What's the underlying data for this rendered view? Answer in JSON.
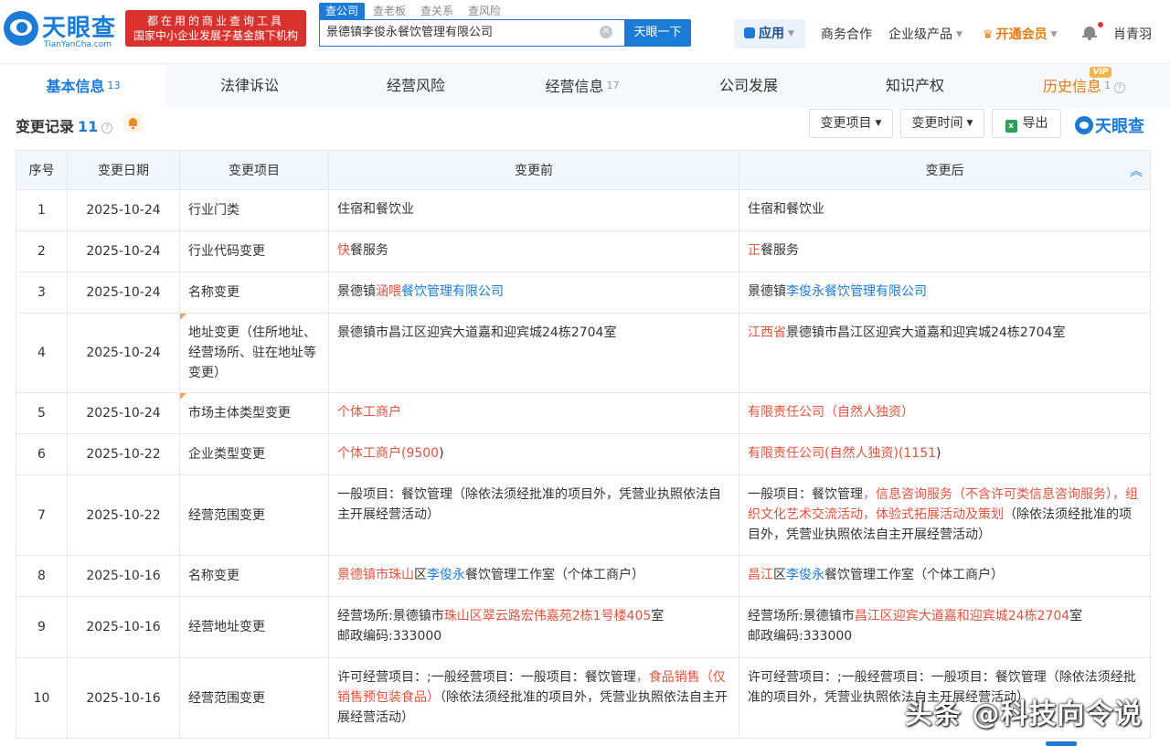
{
  "header": {
    "logo_name": "天眼查",
    "logo_sub": "TianYanCha.com",
    "slogan_line1": "都在用的商业查询工具",
    "slogan_line2": "国家中小企业发展子基金旗下机构",
    "search_tabs": [
      "查公司",
      "查老板",
      "查关系",
      "查风险"
    ],
    "search_value": "景德镇李俊永餐饮管理有限公司",
    "search_button": "天眼一下",
    "nav_apps": "应用",
    "nav_business": "商务合作",
    "nav_enterprise": "企业级产品",
    "nav_vip": "开通会员",
    "user_name": "肖青羽"
  },
  "tabs": [
    {
      "label": "基本信息",
      "count": "13"
    },
    {
      "label": "法律诉讼",
      "count": ""
    },
    {
      "label": "经营风险",
      "count": ""
    },
    {
      "label": "经营信息",
      "count": "17"
    },
    {
      "label": "公司发展",
      "count": ""
    },
    {
      "label": "知识产权",
      "count": ""
    },
    {
      "label": "历史信息",
      "count": "1"
    }
  ],
  "vip_badge": "VIP",
  "section": {
    "title": "变更记录",
    "count": "11",
    "filter_item": "变更项目",
    "filter_time": "变更时间",
    "export": "导出",
    "brand": "天眼查"
  },
  "table": {
    "headers": [
      "序号",
      "变更日期",
      "变更项目",
      "变更前",
      "变更后"
    ],
    "rows": [
      {
        "no": "1",
        "date": "2025-10-24",
        "item": "行业门类",
        "before": [
          {
            "t": "住宿和餐饮业"
          }
        ],
        "after": [
          {
            "t": "住宿和餐饮业"
          }
        ]
      },
      {
        "no": "2",
        "date": "2025-10-24",
        "item": "行业代码变更",
        "before": [
          {
            "t": "快",
            "c": "hl"
          },
          {
            "t": "餐服务"
          }
        ],
        "after": [
          {
            "t": "正",
            "c": "hl"
          },
          {
            "t": "餐服务"
          }
        ]
      },
      {
        "no": "3",
        "date": "2025-10-24",
        "item": "名称变更",
        "before": [
          {
            "t": "景德镇"
          },
          {
            "t": "涵喂",
            "c": "hl"
          },
          {
            "t": "餐饮管理有限公司",
            "c": "lk"
          }
        ],
        "after": [
          {
            "t": "景德镇"
          },
          {
            "t": "李俊永餐饮管理有限公司",
            "c": "lk"
          }
        ]
      },
      {
        "no": "4",
        "date": "2025-10-24",
        "item": "地址变更（住所地址、经营场所、驻在地址等变更）",
        "before": [
          {
            "t": "景德镇市昌江区迎宾大道嘉和迎宾城24栋2704室"
          }
        ],
        "after": [
          {
            "t": "江西省",
            "c": "hl"
          },
          {
            "t": "景德镇市昌江区迎宾大道嘉和迎宾城24栋2704室"
          }
        ]
      },
      {
        "no": "5",
        "date": "2025-10-24",
        "item": "市场主体类型变更",
        "before": [
          {
            "t": "个体工商户",
            "c": "hl"
          }
        ],
        "after": [
          {
            "t": "有限责任公司（自然人独资）",
            "c": "hl"
          }
        ]
      },
      {
        "no": "6",
        "date": "2025-10-22",
        "item": "企业类型变更",
        "before": [
          {
            "t": "个体工商户(9500",
            "c": "hl"
          },
          {
            "t": ")"
          }
        ],
        "after": [
          {
            "t": "有限责任公司(自然人独资)(1151",
            "c": "hl"
          },
          {
            "t": ")"
          }
        ]
      },
      {
        "no": "7",
        "date": "2025-10-22",
        "item": "经营范围变更",
        "before": [
          {
            "t": "一般项目：餐饮管理（除依法须经批准的项目外，凭营业执照依法自主开展经营活动）"
          }
        ],
        "after": [
          {
            "t": "一般项目：餐饮管理"
          },
          {
            "t": "，信息咨询服务（不含许可类信息咨询服务），组织文化艺术交流活动，体验式拓展活动及策划",
            "c": "hl"
          },
          {
            "t": "（除依法须经批准的项目外，凭营业执照依法自主开展经营活动）"
          }
        ]
      },
      {
        "no": "8",
        "date": "2025-10-16",
        "item": "名称变更",
        "before": [
          {
            "t": "景德镇市珠山",
            "c": "hl"
          },
          {
            "t": "区"
          },
          {
            "t": "李俊永",
            "c": "lk"
          },
          {
            "t": "餐饮管理工作室（个体工商户）"
          }
        ],
        "after": [
          {
            "t": "昌江",
            "c": "hl"
          },
          {
            "t": "区"
          },
          {
            "t": "李俊永",
            "c": "lk"
          },
          {
            "t": "餐饮管理工作室（个体工商户）"
          }
        ]
      },
      {
        "no": "9",
        "date": "2025-10-16",
        "item": "经营地址变更",
        "before": [
          {
            "t": "经营场所:景德镇市"
          },
          {
            "t": "珠山区翠云路宏伟嘉苑2栋1号楼405",
            "c": "hl"
          },
          {
            "t": "室"
          },
          {
            "br": true
          },
          {
            "t": "邮政编码:333000"
          }
        ],
        "after": [
          {
            "t": "经营场所:景德镇市"
          },
          {
            "t": "昌江区迎宾大道嘉和迎宾城24栋2704",
            "c": "hl"
          },
          {
            "t": "室"
          },
          {
            "br": true
          },
          {
            "t": "邮政编码:333000"
          }
        ]
      },
      {
        "no": "10",
        "date": "2025-10-16",
        "item": "经营范围变更",
        "before": [
          {
            "t": "许可经营项目：;一般经营项目：一般项目：餐饮管理"
          },
          {
            "t": "，食品销售（仅销售预包装食品）",
            "c": "hl"
          },
          {
            "t": "（除依法须经批准的项目外，凭营业执照依法自主开展经营活动）"
          }
        ],
        "after": [
          {
            "t": "许可经营项目：;一般经营项目：一般项目：餐饮管理（除依法须经批准的项目外，凭营业执照依法自主开展经营活动）"
          }
        ]
      }
    ]
  },
  "watermark": "头条 @科技向令说"
}
